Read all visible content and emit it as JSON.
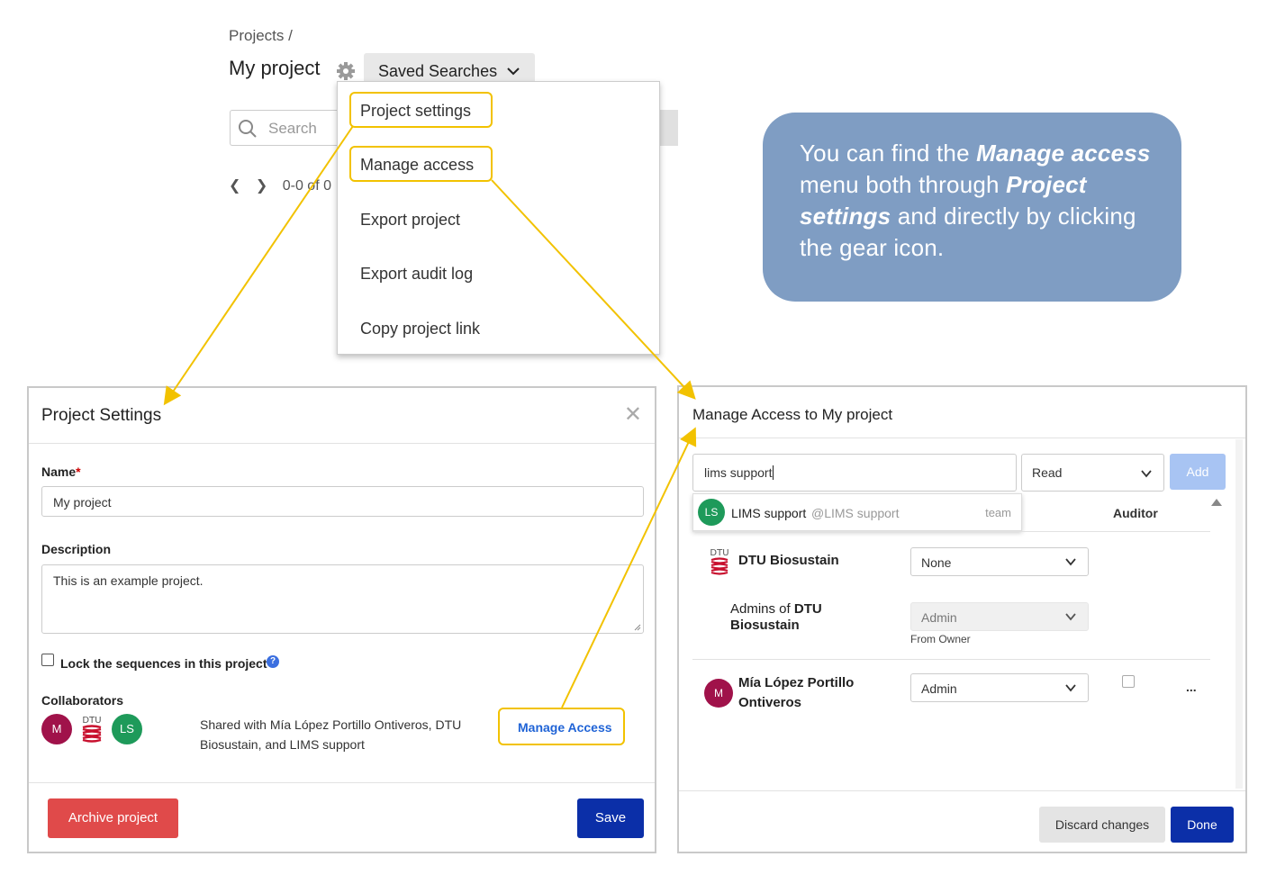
{
  "header": {
    "breadcrumb": "Projects /",
    "project_title": "My project",
    "saved_searches_label": "Saved Searches",
    "search_placeholder": "Search",
    "pager_text": "0-0 of 0"
  },
  "menu": {
    "items": [
      {
        "label": "Project settings"
      },
      {
        "label": "Manage access"
      },
      {
        "label": "Export project"
      },
      {
        "label": "Export audit log"
      },
      {
        "label": "Copy project link"
      }
    ]
  },
  "callout": {
    "text_1": "You can find the ",
    "bold_1": "Manage access",
    "text_2": " menu both through ",
    "bold_2": "Project settings",
    "text_3": " and directly by clicking the gear icon."
  },
  "project_settings": {
    "title": "Project Settings",
    "name_label": "Name",
    "required_mark": "*",
    "name_value": "My project",
    "description_label": "Description",
    "description_value": "This is an example project.",
    "lock_label": "Lock the sequences in this project",
    "collaborators_label": "Collaborators",
    "avatar_m": "M",
    "avatar_ls": "LS",
    "dtu_label": "DTU",
    "shared_text": "Shared with Mía López Portillo Ontiveros, DTU Biosustain, and LIMS support",
    "manage_access_link": "Manage Access",
    "archive_label": "Archive project",
    "save_label": "Save",
    "help_glyph": "?"
  },
  "manage_access": {
    "title": "Manage Access to My project",
    "input_value": "lims support",
    "permission_value": "Read",
    "add_label": "Add",
    "suggestion": {
      "avatar": "LS",
      "name": "LIMS support",
      "handle": "@LIMS support",
      "type": "team"
    },
    "auditor_header": "Auditor",
    "rows": [
      {
        "name": "DTU Biosustain",
        "role": "None"
      },
      {
        "name": "Admins of DTU Biosustain",
        "name_part1": "Admins of ",
        "name_part2": "DTU",
        "name_line2": "Biosustain",
        "role": "Admin",
        "note": "From Owner"
      },
      {
        "name_line1": "Mía López Portillo",
        "name_line2": "Ontiveros",
        "avatar": "M",
        "role": "Admin",
        "more": "..."
      }
    ],
    "discard_label": "Discard changes",
    "done_label": "Done"
  },
  "colors": {
    "highlight": "#f2c200",
    "callout_bg": "#7f9dc3",
    "primary": "#0b2fa8",
    "danger": "#e04a4a",
    "link": "#1f63d6"
  }
}
